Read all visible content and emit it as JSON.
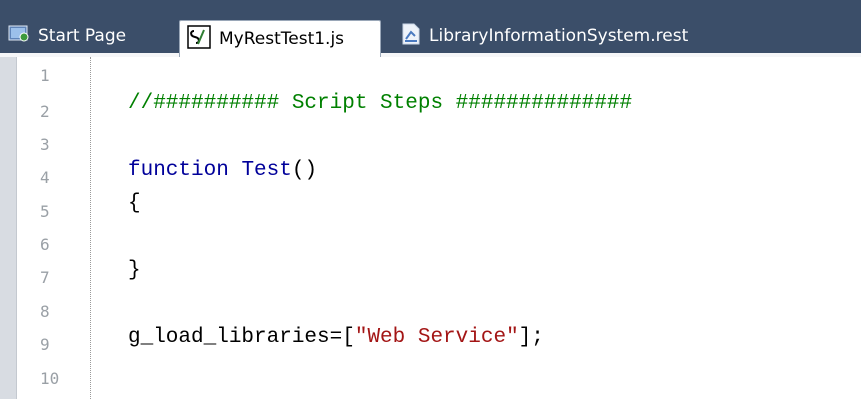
{
  "tabs": [
    {
      "label": "Start Page",
      "icon": "start-page-icon",
      "active": false
    },
    {
      "label": "MyRestTest1.js",
      "icon": "script-icon",
      "active": true
    },
    {
      "label": "LibraryInformationSystem.rest",
      "icon": "rest-file-icon",
      "active": false
    }
  ],
  "editor": {
    "line_numbers": [
      "1",
      "2",
      "3",
      "4",
      "5",
      "6",
      "7",
      "8",
      "9",
      "10"
    ],
    "code": {
      "line2_comment": "//########## Script Steps ##############",
      "line4_keyword": "function",
      "line4_name": "Test",
      "line4_parens": "()",
      "line5": "{",
      "line7": "}",
      "line9_prefix": "g_load_libraries=[",
      "line9_string": "\"Web Service\"",
      "line9_suffix": "];"
    }
  },
  "colors": {
    "tabbar": "#3b4e69",
    "comment": "#008000",
    "keyword": "#00009a",
    "string": "#a31515",
    "line_number": "#9aa0a6"
  }
}
